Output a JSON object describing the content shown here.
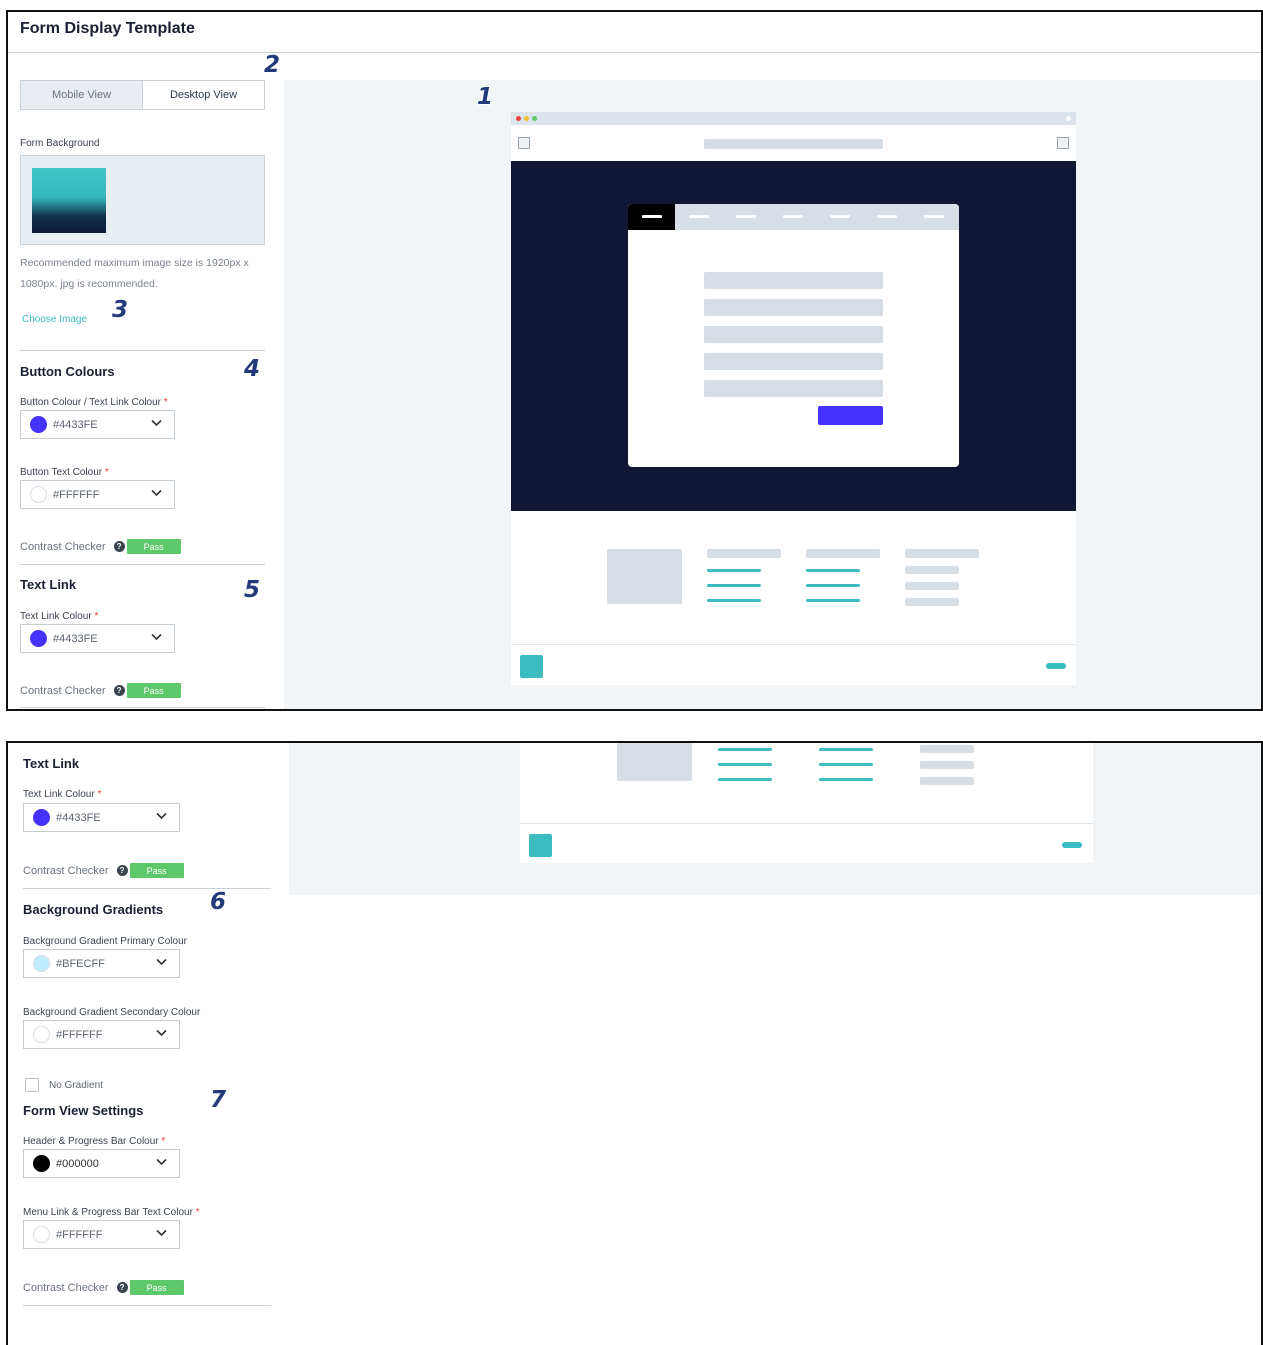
{
  "page": {
    "title": "Form Display Template"
  },
  "view_toggle": {
    "mobile": "Mobile View",
    "desktop": "Desktop View",
    "active": "desktop"
  },
  "form_background": {
    "label": "Form Background",
    "help": "Recommended maximum image size is 1920px x 1080px. jpg is recommended.",
    "choose": "Choose Image"
  },
  "button_colours": {
    "title": "Button Colours",
    "button_colour": {
      "label": "Button Colour / Text Link Colour",
      "required": "*",
      "value": "#4433FE",
      "color": "#4433FE"
    },
    "button_text": {
      "label": "Button Text Colour",
      "required": "*",
      "value": "#FFFFFF",
      "color": "#FFFFFF"
    },
    "contrast": {
      "label": "Contrast Checker",
      "status": "Pass"
    }
  },
  "text_link": {
    "title": "Text Link",
    "colour": {
      "label": "Text Link Colour",
      "required": "*",
      "value": "#4433FE",
      "color": "#4433FE"
    },
    "contrast": {
      "label": "Contrast Checker",
      "status": "Pass"
    }
  },
  "background_gradients": {
    "title": "Background Gradients",
    "primary": {
      "label": "Background Gradient Primary Colour",
      "value": "#BFECFF",
      "color": "#BFECFF"
    },
    "secondary": {
      "label": "Background Gradient Secondary Colour",
      "value": "#FFFFFF",
      "color": "#FFFFFF"
    },
    "no_gradient": {
      "label": "No Gradient",
      "checked": false
    }
  },
  "form_view": {
    "title": "Form View Settings",
    "header": {
      "label": "Header & Progress Bar Colour",
      "required": "*",
      "value": "#000000",
      "color": "#000000"
    },
    "menu_link": {
      "label": "Menu Link & Progress Bar Text Colour",
      "required": "*",
      "value": "#FFFFFF",
      "color": "#FFFFFF"
    },
    "contrast": {
      "label": "Contrast Checker",
      "status": "Pass"
    }
  },
  "badges": [
    "1",
    "2",
    "3",
    "4",
    "5",
    "6",
    "7"
  ],
  "colors": {
    "accent": "#3bbcc0",
    "pass": "#5cc86a",
    "hero": "#111634",
    "button": "#4433FE"
  },
  "icons": {
    "help": "question-circle-icon",
    "chevron": "chevron-down-icon",
    "broken_image": "broken-image-icon"
  }
}
